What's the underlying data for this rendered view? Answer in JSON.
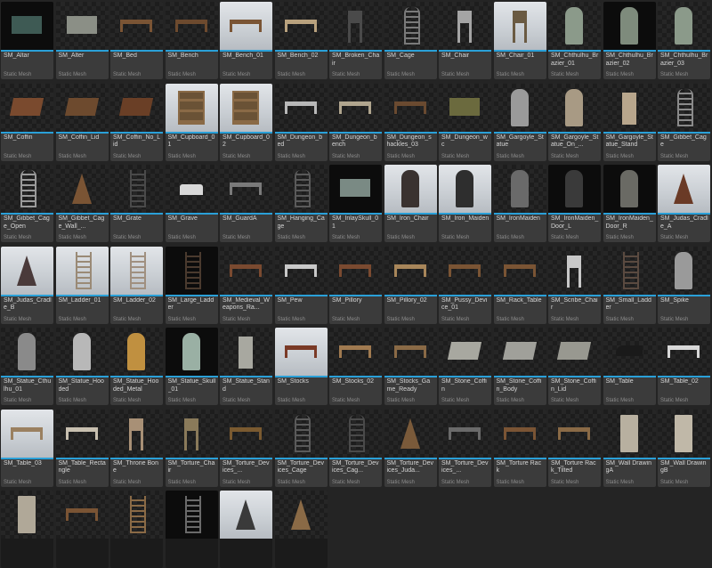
{
  "asset_type_label": "Static Mesh",
  "colors": {
    "accent": "#2aa0d8",
    "stone": "#8b8f86",
    "wood": "#7a5434",
    "metal": "#5a5a5a"
  },
  "assets": [
    {
      "name": "SM_Altar",
      "thumb": "dark",
      "icon": "altar-icon",
      "color": "#3e5a54"
    },
    {
      "name": "SM_Alter",
      "thumb": "normal",
      "icon": "altar-icon",
      "color": "#8b8f86"
    },
    {
      "name": "SM_Bed",
      "thumb": "normal",
      "icon": "bed-icon",
      "color": "#7a5434"
    },
    {
      "name": "SM_Bench",
      "thumb": "normal",
      "icon": "bench-icon",
      "color": "#6d4a2e"
    },
    {
      "name": "SM_Bench_01",
      "thumb": "light",
      "icon": "bench-icon",
      "color": "#7a5434"
    },
    {
      "name": "SM_Bench_02",
      "thumb": "normal",
      "icon": "bench-icon",
      "color": "#b9a27e"
    },
    {
      "name": "SM_Broken_Chair",
      "thumb": "normal",
      "icon": "chair-icon",
      "color": "#4a4a4a"
    },
    {
      "name": "SM_Cage",
      "thumb": "normal",
      "icon": "cage-icon",
      "color": "#7a7a7a"
    },
    {
      "name": "SM_Chair",
      "thumb": "normal",
      "icon": "chair-icon",
      "color": "#a5a5a5"
    },
    {
      "name": "SM_Chair_01",
      "thumb": "light",
      "icon": "chair-icon",
      "color": "#6a5a42"
    },
    {
      "name": "SM_Chthulhu_Brazier_01",
      "thumb": "normal",
      "icon": "statue-icon",
      "color": "#8b9a8a"
    },
    {
      "name": "SM_Chthulhu_Brazier_02",
      "thumb": "dark",
      "icon": "statue-icon",
      "color": "#7e8b7c"
    },
    {
      "name": "SM_Chthulhu_Brazier_03",
      "thumb": "normal",
      "icon": "statue-icon",
      "color": "#8b9a8a"
    },
    {
      "name": "SM_Coffin",
      "thumb": "normal",
      "icon": "coffin-icon",
      "color": "#7a4a2e"
    },
    {
      "name": "SM_Coffin_Lid",
      "thumb": "normal",
      "icon": "coffin-icon",
      "color": "#6d4a2e"
    },
    {
      "name": "SM_Coffin_No_Lid",
      "thumb": "normal",
      "icon": "coffin-icon",
      "color": "#6a3f26"
    },
    {
      "name": "SM_Cupboard_01",
      "thumb": "light",
      "icon": "cupboard-icon",
      "color": "#8a6a46"
    },
    {
      "name": "SM_Cupboard_02",
      "thumb": "light",
      "icon": "cupboard-icon",
      "color": "#8a6a46"
    },
    {
      "name": "SM_Dungeon_bed",
      "thumb": "normal",
      "icon": "bed-icon",
      "color": "#b8b8b8"
    },
    {
      "name": "SM_Dungeon_bench",
      "thumb": "normal",
      "icon": "bench-icon",
      "color": "#b0a58e"
    },
    {
      "name": "SM_Dungeon_shackles_03",
      "thumb": "normal",
      "icon": "shackles-icon",
      "color": "#6a4a30"
    },
    {
      "name": "SM_Dungeon_wc",
      "thumb": "normal",
      "icon": "box-icon",
      "color": "#6b6a3e"
    },
    {
      "name": "SM_Gargoyle_Statue",
      "thumb": "normal",
      "icon": "statue-icon",
      "color": "#9a9a9a"
    },
    {
      "name": "SM_Gargoyle_Statue_On_...",
      "thumb": "normal",
      "icon": "statue-icon",
      "color": "#a89a84"
    },
    {
      "name": "SM_Gargoyle_Statue_Stand",
      "thumb": "normal",
      "icon": "pedestal-icon",
      "color": "#b8a68c"
    },
    {
      "name": "SM_Gibbet_Cage",
      "thumb": "normal",
      "icon": "cage-icon",
      "color": "#8a8a8a"
    },
    {
      "name": "SM_Gibbet_Cage_Open",
      "thumb": "normal",
      "icon": "cage-icon",
      "color": "#9a9a9a"
    },
    {
      "name": "SM_Gibbet_Cage_Wall_...",
      "thumb": "normal",
      "icon": "gibbet-icon",
      "color": "#7a5434"
    },
    {
      "name": "SM_Grate",
      "thumb": "normal",
      "icon": "grate-icon",
      "color": "#4a4a4a"
    },
    {
      "name": "SM_Grave",
      "thumb": "normal",
      "icon": "grave-icon",
      "color": "#d8d8d8"
    },
    {
      "name": "SM_GuardA",
      "thumb": "normal",
      "icon": "chain-icon",
      "color": "#7a7a7a"
    },
    {
      "name": "SM_Hanging_Cage",
      "thumb": "normal",
      "icon": "cage-icon",
      "color": "#5a5a5a"
    },
    {
      "name": "SM_InlaySkull_01",
      "thumb": "dark",
      "icon": "plaque-icon",
      "color": "#7a8a84"
    },
    {
      "name": "SM_Iron_Chair",
      "thumb": "light",
      "icon": "iron-maiden-icon",
      "color": "#3a3230"
    },
    {
      "name": "SM_Iron_Maiden",
      "thumb": "light",
      "icon": "iron-maiden-icon",
      "color": "#2e2e2e"
    },
    {
      "name": "SM_IronMaiden",
      "thumb": "normal",
      "icon": "iron-maiden-icon",
      "color": "#6a6a6a"
    },
    {
      "name": "SM_IronMaiden_Door_L",
      "thumb": "dark",
      "icon": "door-icon",
      "color": "#3a3a3a"
    },
    {
      "name": "SM_IronMaiden_Door_R",
      "thumb": "dark",
      "icon": "door-icon",
      "color": "#6a6a64"
    },
    {
      "name": "SM_Judas_Cradle_A",
      "thumb": "light",
      "icon": "cradle-icon",
      "color": "#6a3a26"
    },
    {
      "name": "SM_Judas_Cradle_B",
      "thumb": "light",
      "icon": "cradle-icon",
      "color": "#4a3a3a"
    },
    {
      "name": "SM_Ladder_01",
      "thumb": "light",
      "icon": "ladder-icon",
      "color": "#9a8a76"
    },
    {
      "name": "SM_Ladder_02",
      "thumb": "light",
      "icon": "ladder-icon",
      "color": "#a09080"
    },
    {
      "name": "SM_Large_Ladder",
      "thumb": "dark",
      "icon": "ladder-icon",
      "color": "#4a3a2e"
    },
    {
      "name": "SM_Medieval_Weapons_Ra...",
      "thumb": "normal",
      "icon": "rack-icon",
      "color": "#7a4a30"
    },
    {
      "name": "SM_Pew",
      "thumb": "normal",
      "icon": "bench-icon",
      "color": "#c8c8c8"
    },
    {
      "name": "SM_Pillory",
      "thumb": "normal",
      "icon": "pillory-icon",
      "color": "#7a4a30"
    },
    {
      "name": "SM_Pillory_02",
      "thumb": "normal",
      "icon": "pillory-icon",
      "color": "#a8865a"
    },
    {
      "name": "SM_Pussy_Device_01",
      "thumb": "normal",
      "icon": "device-icon",
      "color": "#7a5434"
    },
    {
      "name": "SM_Rack_Table",
      "thumb": "normal",
      "icon": "table-icon",
      "color": "#7a5434"
    },
    {
      "name": "SM_Scribe_Chair",
      "thumb": "normal",
      "icon": "stool-icon",
      "color": "#c8c8c8"
    },
    {
      "name": "SM_Small_Ladder",
      "thumb": "normal",
      "icon": "ladder-icon",
      "color": "#5a4a40"
    },
    {
      "name": "SM_Spike",
      "thumb": "normal",
      "icon": "spike-icon",
      "color": "#9a9a9a"
    },
    {
      "name": "SM_Statue_Cthulhu_01",
      "thumb": "normal",
      "icon": "statue-icon",
      "color": "#8a8a8a"
    },
    {
      "name": "SM_Statue_Hooded",
      "thumb": "normal",
      "icon": "statue-icon",
      "color": "#b8b8b8"
    },
    {
      "name": "SM_Statue_Hooded_Metal",
      "thumb": "normal",
      "icon": "statue-icon",
      "color": "#c09040"
    },
    {
      "name": "SM_Statue_Skull_01",
      "thumb": "dark",
      "icon": "skull-icon",
      "color": "#9ab0a4"
    },
    {
      "name": "SM_Statue_Stand",
      "thumb": "normal",
      "icon": "pedestal-icon",
      "color": "#a8a8a0"
    },
    {
      "name": "SM_Stocks",
      "thumb": "light",
      "icon": "stocks-icon",
      "color": "#7a3a26"
    },
    {
      "name": "SM_Stocks_02",
      "thumb": "normal",
      "icon": "stocks-icon",
      "color": "#a07a50"
    },
    {
      "name": "SM_Stocks_Game_Ready",
      "thumb": "normal",
      "icon": "stocks-icon",
      "color": "#8a6a46"
    },
    {
      "name": "SM_Stone_Coffin",
      "thumb": "normal",
      "icon": "coffin-icon",
      "color": "#a8a8a0"
    },
    {
      "name": "SM_Stone_Coffin_Body",
      "thumb": "normal",
      "icon": "coffin-icon",
      "color": "#a0a09a"
    },
    {
      "name": "SM_Stone_Coffin_Lid",
      "thumb": "normal",
      "icon": "coffin-icon",
      "color": "#989890"
    },
    {
      "name": "SM_Table",
      "thumb": "normal",
      "icon": "anvil-icon",
      "color": "#1a1a1a"
    },
    {
      "name": "SM_Table_02",
      "thumb": "normal",
      "icon": "table-icon",
      "color": "#d8d8d8"
    },
    {
      "name": "SM_Table_03",
      "thumb": "light",
      "icon": "table-icon",
      "color": "#9a8060"
    },
    {
      "name": "SM_Table_Rectangle",
      "thumb": "normal",
      "icon": "table-icon",
      "color": "#c8c0b0"
    },
    {
      "name": "SM_Throne Bone",
      "thumb": "normal",
      "icon": "throne-icon",
      "color": "#a89076"
    },
    {
      "name": "SM_Torture_Chair",
      "thumb": "normal",
      "icon": "chair-icon",
      "color": "#8a7a5a"
    },
    {
      "name": "SM_Torture_Devices_...",
      "thumb": "normal",
      "icon": "device-icon",
      "color": "#7a5a30"
    },
    {
      "name": "SM_Torture_Devices_Cage",
      "thumb": "normal",
      "icon": "cage-icon",
      "color": "#5a5a5a"
    },
    {
      "name": "SM_Torture_Devices_Cag...",
      "thumb": "normal",
      "icon": "cage-icon",
      "color": "#4a4a4a"
    },
    {
      "name": "SM_Torture_Devices_Juda...",
      "thumb": "normal",
      "icon": "cradle-icon",
      "color": "#7a5a3a"
    },
    {
      "name": "SM_Torture_Devices_...",
      "thumb": "normal",
      "icon": "bench-icon",
      "color": "#6a6a6a"
    },
    {
      "name": "SM_Torture Rack",
      "thumb": "normal",
      "icon": "rack-icon",
      "color": "#7a5434"
    },
    {
      "name": "SM_Torture Rack_Tilted",
      "thumb": "normal",
      "icon": "rack-icon",
      "color": "#8a6a46"
    },
    {
      "name": "SM_Wall DrawingA",
      "thumb": "normal",
      "icon": "panel-icon",
      "color": "#b8b0a0"
    },
    {
      "name": "SM_Wall DrawingB",
      "thumb": "normal",
      "icon": "panel-icon",
      "color": "#c0b8a8"
    },
    {
      "name": "",
      "thumb": "normal",
      "icon": "panel-icon",
      "color": "#b0a898",
      "partial": true
    },
    {
      "name": "",
      "thumb": "normal",
      "icon": "rack-icon",
      "color": "#7a5434",
      "partial": true
    },
    {
      "name": "",
      "thumb": "normal",
      "icon": "ladder-icon",
      "color": "#8a6a46",
      "partial": true
    },
    {
      "name": "",
      "thumb": "dark",
      "icon": "grate-icon",
      "color": "#6a6a6a",
      "partial": true
    },
    {
      "name": "",
      "thumb": "light",
      "icon": "cradle-icon",
      "color": "#3a3a3a",
      "partial": true
    },
    {
      "name": "",
      "thumb": "normal",
      "icon": "cradle-icon",
      "color": "#8a6a46",
      "partial": true
    }
  ]
}
